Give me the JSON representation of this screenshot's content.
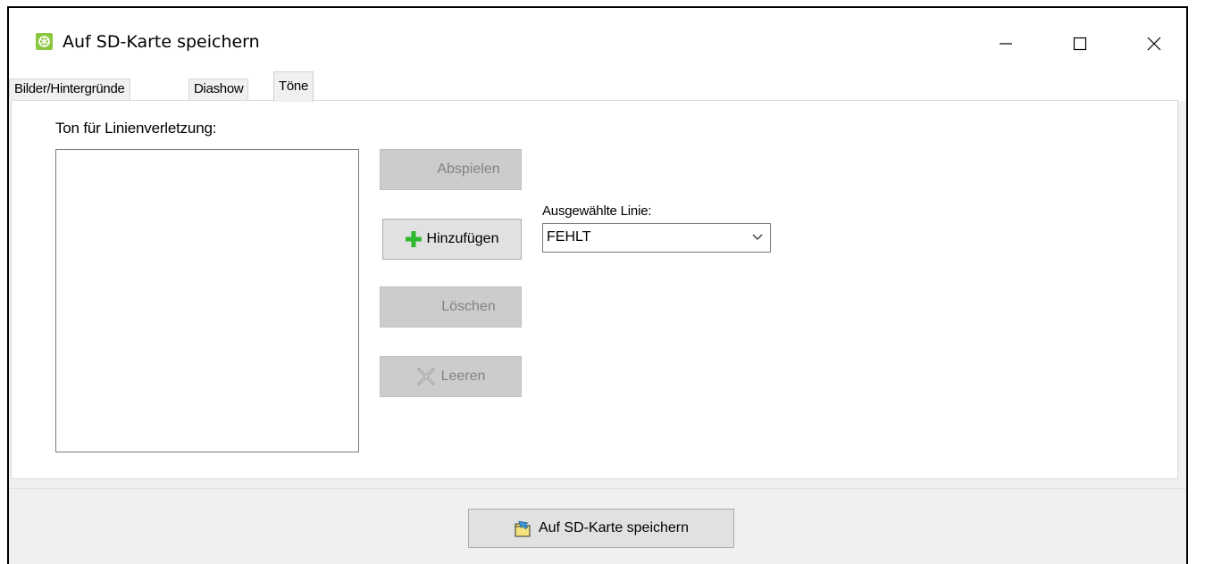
{
  "window": {
    "title": "Auf SD-Karte speichern",
    "icon": "app-icon",
    "controls": {
      "minimize": "minimize-icon",
      "maximize": "maximize-icon",
      "close": "close-icon"
    }
  },
  "tabs": [
    {
      "label": "Bilder/Hintergründe",
      "active": false
    },
    {
      "label": "Diashow",
      "active": false
    },
    {
      "label": "Töne",
      "active": true
    }
  ],
  "sound_panel": {
    "list_label": "Ton für Linienverletzung:",
    "buttons": {
      "play": "Abspielen",
      "add": "Hinzufügen",
      "delete": "Löschen",
      "clear": "Leeren"
    },
    "selected_line_label": "Ausgewählte Linie:",
    "selected_line_value": "FEHLT"
  },
  "footer": {
    "save_label": "Auf SD-Karte speichern"
  },
  "colors": {
    "add_icon": "#2db82d",
    "app_icon": "#8cc63f",
    "disabled_bg": "#cccccc"
  }
}
